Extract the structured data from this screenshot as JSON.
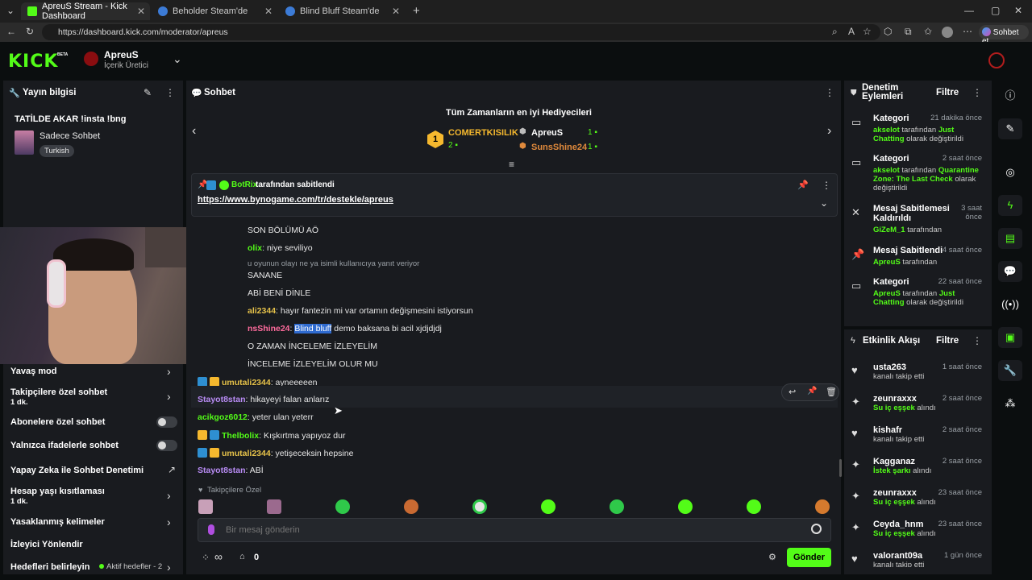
{
  "browser": {
    "tabs": [
      {
        "title": "ApreuS Stream - Kick Dashboard",
        "active": true
      },
      {
        "title": "Beholder Steam'de",
        "active": false
      },
      {
        "title": "Blind Bluff Steam'de",
        "active": false
      }
    ],
    "url": "https://dashboard.kick.com/moderator/apreus",
    "profile_button": "Sohbet et"
  },
  "header": {
    "logo": "KICK",
    "beta": "BETA",
    "channel_name": "ApreuS",
    "channel_role": "İçerik Üretici"
  },
  "stream_info": {
    "title": "Yayın bilgisi",
    "stream_title": "TATİLDE AKAR !insta !bng",
    "category": "Sadece Sohbet",
    "language_tag": "Turkish"
  },
  "chat_settings": [
    {
      "label": "Yavaş mod",
      "sub": "",
      "control": "chevron"
    },
    {
      "label": "Takipçilere özel sohbet",
      "sub": "1 dk.",
      "control": "chevron"
    },
    {
      "label": "Abonelere özel sohbet",
      "sub": "",
      "control": "toggle"
    },
    {
      "label": "Yalnızca ifadelerle sohbet",
      "sub": "",
      "control": "toggle"
    },
    {
      "label": "Yapay Zeka ile Sohbet Denetimi",
      "sub": "",
      "control": "external"
    },
    {
      "label": "Hesap yaşı kısıtlaması",
      "sub": "1 dk.",
      "control": "chevron"
    },
    {
      "label": "Yasaklanmış kelimeler",
      "sub": "",
      "control": "chevron"
    },
    {
      "label": "İzleyici Yönlendir",
      "sub": "",
      "control": "none"
    },
    {
      "label": "Hedefleri belirleyin",
      "sub": "",
      "control": "chevron",
      "extra": "Aktif hedefler - 2"
    }
  ],
  "chat": {
    "title": "Sohbet",
    "gifters_title": "Tüm Zamanların en iyi Hediyecileri",
    "gifters": [
      {
        "rank": "1",
        "name": "COMERTKISILIK",
        "count": "2"
      },
      {
        "rank": "",
        "name": "ApreuS",
        "count": "1"
      },
      {
        "rank": "",
        "name": "SunsShine24",
        "count": "1"
      }
    ],
    "pinned_by_user": "BotRix",
    "pinned_by_text": "tarafından sabitlendi",
    "pinned_link": "https://www.bynogame.com/tr/destekle/apreus",
    "messages": [
      {
        "user": "",
        "text": "SON BÖLÜMÜ AÖ",
        "color": "#ffffff"
      },
      {
        "user": "olix",
        "text": "niye seviliyo",
        "color": "#53fc18"
      },
      {
        "user": "",
        "text": "u oyunun olayı ne ya isimli kullanıcıya yanıt veriyor",
        "color": "#9aa0a6"
      },
      {
        "user": "",
        "text": "SANANE",
        "color": "#ffffff"
      },
      {
        "user": "",
        "text": "ABİ BENİ DİNLE",
        "color": "#ffffff"
      },
      {
        "user": "ali2344",
        "text": "hayır fantezin mi var ortamın değişmesini istiyorsun",
        "color": "#e6c24a"
      },
      {
        "user": "nsShine24",
        "text": "demo baksana bi acil xjdjdjdj",
        "color": "#ff6b9d",
        "highlight": "Blind bluff"
      },
      {
        "user": "",
        "text": "O ZAMAN İNCELEME İZLEYELİM",
        "color": "#ffffff"
      },
      {
        "user": "",
        "text": "İNCELEME İZLEYELİM OLUR MU",
        "color": "#ffffff"
      },
      {
        "user": "umutali2344",
        "text": "ayneeeeen",
        "color": "#e6c24a"
      },
      {
        "user": "Stayot8stan",
        "text": "hikayeyi falan anlarız",
        "color": "#b98cf5"
      },
      {
        "user": "acikgoz6012",
        "text": "yeter ulan yeterr",
        "color": "#53fc18"
      },
      {
        "user": "Thelbolix",
        "text": "Kışkırtma yapıyoz dur",
        "color": "#53fc18"
      },
      {
        "user": "umutali2344",
        "text": "yetişeceksin hepsine",
        "color": "#e6c24a"
      },
      {
        "user": "Stayot8stan",
        "text": "ABİ",
        "color": "#b98cf5"
      }
    ],
    "followers_only_label": "Takipçilere Özel",
    "input_placeholder": "Bir mesaj gönderin",
    "viewer_symbol": "∞",
    "points": "0",
    "send_button": "Gönder"
  },
  "mod_actions": {
    "title": "Denetim Eylemleri",
    "filter": "Filtre",
    "items": [
      {
        "title": "Kategori",
        "time": "21 dakika önce",
        "user": "akselot",
        "text": " tarafından ",
        "highlight": "Just Chatting",
        "tail": " olarak değiştirildi"
      },
      {
        "title": "Kategori",
        "time": "2 saat önce",
        "user": "akselot",
        "text": " tarafından ",
        "highlight": "Quarantine Zone: The Last Check",
        "tail": " olarak değiştirildi"
      },
      {
        "title": "Mesaj Sabitlemesi Kaldırıldı",
        "time": "3 saat önce",
        "user": "GiZeM_1",
        "text": " tarafından",
        "highlight": "",
        "tail": ""
      },
      {
        "title": "Mesaj Sabitlendi",
        "time": "4 saat önce",
        "user": "ApreuS",
        "text": " tarafından",
        "highlight": "",
        "tail": ""
      },
      {
        "title": "Kategori",
        "time": "22 saat önce",
        "user": "ApreuS",
        "text": " tarafından ",
        "highlight": "Just Chatting",
        "tail": " olarak değiştirildi"
      }
    ]
  },
  "activity": {
    "title": "Etkinlik Akışı",
    "filter": "Filtre",
    "items": [
      {
        "user": "usta263",
        "time": "1 saat önce",
        "text": "kanalı takip etti",
        "green": ""
      },
      {
        "user": "zeunraxxx",
        "time": "2 saat önce",
        "text": " alındı",
        "green": "Su iç eşşek"
      },
      {
        "user": "kishafr",
        "time": "2 saat önce",
        "text": "kanalı takip etti",
        "green": ""
      },
      {
        "user": "Kagganaz",
        "time": "2 saat önce",
        "text": " alındı",
        "green": "İstek şarkı"
      },
      {
        "user": "zeunraxxx",
        "time": "23 saat önce",
        "text": " alındı",
        "green": "Su iç eşşek"
      },
      {
        "user": "Ceyda_hnm",
        "time": "23 saat önce",
        "text": " alındı",
        "green": "Su iç eşşek"
      },
      {
        "user": "valorant09a",
        "time": "1 gün önce",
        "text": "kanalı takip etti",
        "green": ""
      }
    ]
  },
  "colors": {
    "accent": "#53fc18",
    "panel": "#191b1f",
    "background": "#0b0e0f"
  }
}
